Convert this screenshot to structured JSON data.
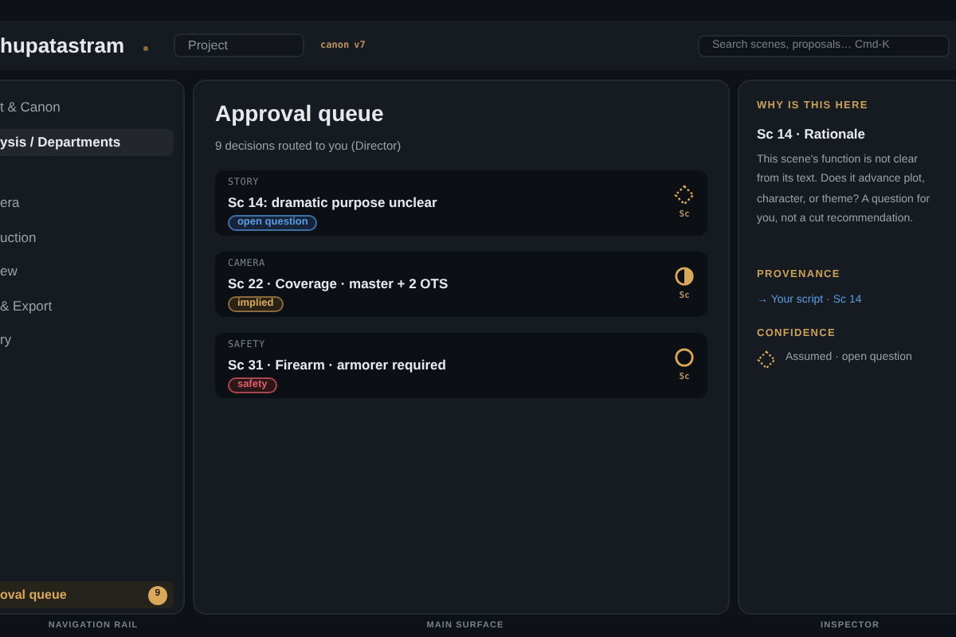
{
  "header": {
    "app_name": "hupatastram",
    "project_placeholder": "Project",
    "canon_label": "canon",
    "canon_version": "v7",
    "search_placeholder": "Search scenes, proposals… Cmd-K"
  },
  "nav": {
    "items": [
      {
        "label": "t & Canon",
        "selected": false
      },
      {
        "label": "ysis / Departments",
        "selected": true
      },
      {
        "label": "era",
        "selected": false
      },
      {
        "label": "uction",
        "selected": false
      },
      {
        "label": "ew",
        "selected": false
      },
      {
        "label": "& Export",
        "selected": false
      },
      {
        "label": "ry",
        "selected": false
      }
    ],
    "footer_item": {
      "label": "oval queue",
      "count": "9"
    }
  },
  "main": {
    "title": "Approval queue",
    "subtitle": "9 decisions routed to you (Director)",
    "cards": [
      {
        "department": "STORY",
        "title": "Sc 14: dramatic purpose unclear",
        "tag": {
          "label": "open question",
          "kind": "question"
        },
        "confidence": {
          "kind": "assumed",
          "label": "Sc"
        }
      },
      {
        "department": "CAMERA",
        "title": "Sc 22 · Coverage · master + 2 OTS",
        "tag": {
          "label": "implied",
          "kind": "implied"
        },
        "confidence": {
          "kind": "implied",
          "label": "Sc"
        }
      },
      {
        "department": "SAFETY",
        "title": "Sc 31 · Firearm · armorer required",
        "tag": {
          "label": "safety",
          "kind": "safety"
        },
        "confidence": {
          "kind": "none",
          "label": "Sc"
        }
      }
    ]
  },
  "inspector": {
    "why_heading": "WHY IS THIS HERE",
    "title": "Sc 14 · Rationale",
    "body": "This scene's function is not clear from its text. Does it advance plot, character, or theme? A question for you, not a cut recommendation.",
    "provenance_heading": "PROVENANCE",
    "provenance_link": "→ Your script · Sc 14",
    "confidence_heading": "CONFIDENCE",
    "confidence": {
      "kind": "assumed",
      "text": "Assumed · open question"
    }
  },
  "footer": {
    "labels": [
      "NAVIGATION RAIL",
      "MAIN SURFACE",
      "INSPECTOR"
    ]
  }
}
